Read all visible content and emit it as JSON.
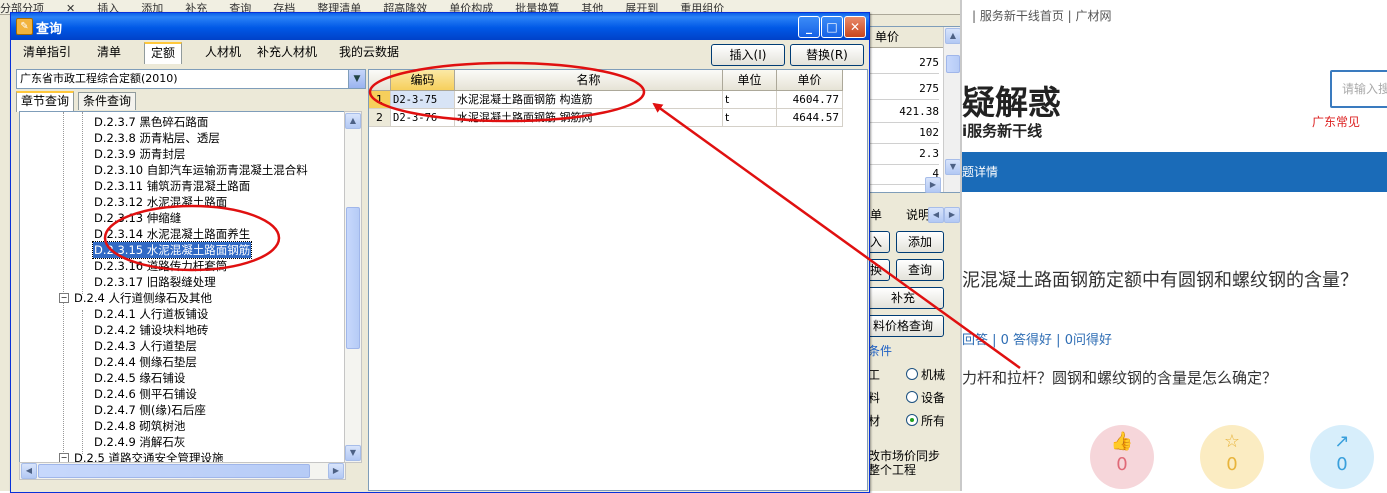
{
  "bg_menu": [
    "分部分项",
    "✕",
    "插入",
    "添加",
    "补充",
    "查询",
    "存档",
    "整理清单",
    "超高降效",
    "单价构成",
    "批量换算",
    "其他",
    "展开到",
    "重用组价"
  ],
  "bg_table": {
    "header": "单价",
    "values": [
      "275",
      "275",
      "421.38",
      "102",
      "2.3",
      "4"
    ]
  },
  "bg_panel": {
    "tab1": "单",
    "tab2": "说明",
    "btn_insert_partial": "入",
    "btn_add": "添加",
    "btn_replace_partial": "换",
    "btn_query": "查询",
    "btn_supplement": "补充",
    "btn_price_query": "料价格查询",
    "cond_label": "条件",
    "radios": [
      {
        "prefix": "工",
        "label": "机械",
        "checked": false
      },
      {
        "prefix": "料",
        "label": "设备",
        "checked": false
      },
      {
        "prefix": "材",
        "label": "所有",
        "checked": true
      }
    ],
    "sync_text_1": "改市场价同步",
    "sync_text_2": "整个工程"
  },
  "web": {
    "nav": "|  服务新干线首页  |  广材网",
    "big_title": "疑解惑",
    "subtitle": "i服务新干线",
    "search_placeholder": "请输入搜",
    "gd_link": "广东常见",
    "blue_bar": "题详情",
    "question": "泥混凝土路面钢筋定额中有圆钢和螺纹钢的含量？",
    "stats": "回答 | 0 答得好 | 0问得好",
    "desc": "力杆和拉杆？圆钢和螺纹钢的含量是怎么确定？",
    "circles": [
      {
        "icon": "thumbs-up",
        "count": "0",
        "color": "#f6d6da",
        "fg": "#e06a78"
      },
      {
        "icon": "star",
        "count": "0",
        "color": "#fbecc2",
        "fg": "#e8b43c"
      },
      {
        "icon": "share",
        "count": "0",
        "color": "#d7eefb",
        "fg": "#3aa0dc"
      }
    ]
  },
  "dialog": {
    "title": "查询",
    "tabs": [
      "清单指引",
      "清单",
      "定额",
      "人材机",
      "补充人材机",
      "我的云数据"
    ],
    "selected_tab": "定额",
    "insert_btn": "插入(I)",
    "replace_btn": "替换(R)",
    "combo_value": "广东省市政工程综合定额(2010)",
    "subtabs": [
      "章节查询",
      "条件查询"
    ],
    "tree": [
      {
        "text": "D.2.3.7 黑色碎石路面",
        "level": 2
      },
      {
        "text": "D.2.3.8 沥青粘层、透层",
        "level": 2
      },
      {
        "text": "D.2.3.9 沥青封层",
        "level": 2
      },
      {
        "text": "D.2.3.10 自卸汽车运输沥青混凝土混合料",
        "level": 2
      },
      {
        "text": "D.2.3.11 铺筑沥青混凝土路面",
        "level": 2
      },
      {
        "text": "D.2.3.12 水泥混凝土路面",
        "level": 2
      },
      {
        "text": "D.2.3.13 伸缩缝",
        "level": 2
      },
      {
        "text": "D.2.3.14 水泥混凝土路面养生",
        "level": 2
      },
      {
        "text": "D.2.3.15 水泥混凝土路面钢筋",
        "level": 2,
        "selected": true
      },
      {
        "text": "D.2.3.16 道路传力杆套筒",
        "level": 2
      },
      {
        "text": "D.2.3.17 旧路裂缝处理",
        "level": 2
      },
      {
        "text": "D.2.4 人行道侧缘石及其他",
        "level": 1,
        "expander": "−"
      },
      {
        "text": "D.2.4.1 人行道板铺设",
        "level": 2
      },
      {
        "text": "D.2.4.2 铺设块料地砖",
        "level": 2
      },
      {
        "text": "D.2.4.3 人行道垫层",
        "level": 2
      },
      {
        "text": "D.2.4.4 侧缘石垫层",
        "level": 2
      },
      {
        "text": "D.2.4.5 缘石铺设",
        "level": 2
      },
      {
        "text": "D.2.4.6 侧平石铺设",
        "level": 2
      },
      {
        "text": "D.2.4.7 侧(缘)石后座",
        "level": 2
      },
      {
        "text": "D.2.4.8 砌筑树池",
        "level": 2
      },
      {
        "text": "D.2.4.9 消解石灰",
        "level": 2
      },
      {
        "text": "D.2.5 道路交通安全管理设施",
        "level": 1,
        "expander": "−"
      }
    ],
    "grid": {
      "columns": [
        "编码",
        "名称",
        "单位",
        "单价"
      ],
      "rows": [
        {
          "n": "1",
          "code": "D2-3-75",
          "name": "水泥混凝土路面钢筋 构造筋",
          "unit": "t",
          "price": "4604.77"
        },
        {
          "n": "2",
          "code": "D2-3-76",
          "name": "水泥混凝土路面钢筋 钢筋网",
          "unit": "t",
          "price": "4644.57"
        }
      ]
    }
  },
  "colors": {
    "annotation": "#e01010",
    "title_blue": "#0058e6",
    "selection": "#316ac5"
  }
}
